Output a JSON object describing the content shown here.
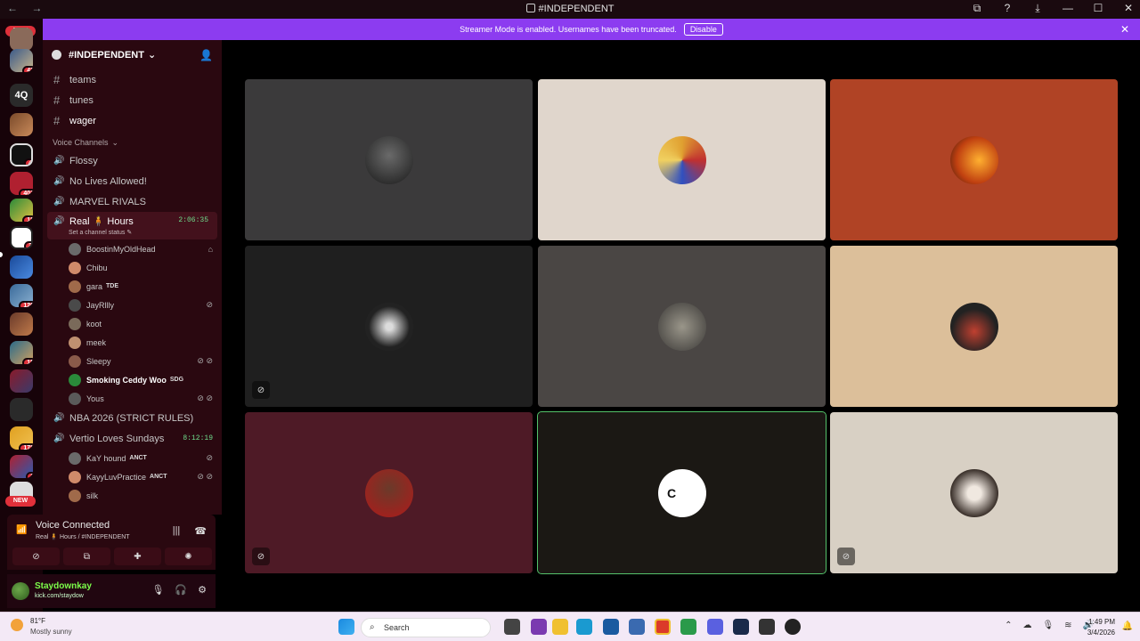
{
  "window": {
    "title": "#INDEPENDENT",
    "nav": "← →",
    "controls": [
      "⧉",
      "?",
      "⤓",
      "—",
      "☐",
      "✕"
    ]
  },
  "banner": {
    "text": "Streamer Mode is enabled. Usernames have been truncated.",
    "button": "Disable",
    "close": "✕"
  },
  "servers": {
    "new_label": "NEW",
    "badges": [
      "43",
      "4",
      "401",
      "18",
      "3",
      "126",
      "15",
      "178",
      "1"
    ],
    "text_icon": "4Q"
  },
  "guild": {
    "name": "#INDEPENDENT",
    "text_channels": [
      "teams",
      "tunes",
      "wager"
    ],
    "voice_category": "Voice Channels",
    "voice_channels": [
      "Flossy",
      "No Lives Allowed!",
      "MARVEL RIVALS"
    ],
    "active_channel": {
      "name": "Real 🧍 Hours",
      "timer": "2:06:35",
      "status": "Set a channel status"
    },
    "members": [
      {
        "name": "BoostinMyOldHead",
        "tag": "",
        "icon": "⌂"
      },
      {
        "name": "Chibu",
        "tag": "",
        "icon": ""
      },
      {
        "name": "gara",
        "tag": "TDE",
        "icon": ""
      },
      {
        "name": "JayRllly",
        "tag": "",
        "icon": "⊘"
      },
      {
        "name": "koot",
        "tag": "",
        "icon": ""
      },
      {
        "name": "meek",
        "tag": "",
        "icon": ""
      },
      {
        "name": "Sleepy",
        "tag": "",
        "icon": "⊘ ⊘"
      },
      {
        "name": "Smoking Ceddy Woo",
        "tag": "SDG",
        "icon": ""
      },
      {
        "name": "Yous",
        "tag": "",
        "icon": "⊘ ⊘"
      }
    ],
    "other_channel": "NBA 2026 (STRICT RULES)",
    "second_channel": {
      "name": "Vertio Loves Sundays",
      "timer": "8:12:19"
    },
    "second_members": [
      {
        "name": "KaY hound",
        "tag": "ANCT",
        "icon": "⊘"
      },
      {
        "name": "KayyLuvPractice",
        "tag": "ANCT",
        "icon": "⊘ ⊘"
      },
      {
        "name": "silk",
        "tag": "",
        "icon": ""
      }
    ]
  },
  "voice": {
    "status": "Voice Connected",
    "location": "Real 🧍 Hours / #INDEPENDENT"
  },
  "user": {
    "name": "Staydownkay",
    "sub": "kick.com/staydow"
  },
  "taskbar": {
    "temp": "81°F",
    "weather": "Mostly sunny",
    "search": "Search",
    "time": "1:49 PM",
    "date": "3/4/2026"
  },
  "colors": {
    "accent": "#8c3cf0",
    "sidebar": "#2a0810",
    "speaking": "#54c26a"
  }
}
